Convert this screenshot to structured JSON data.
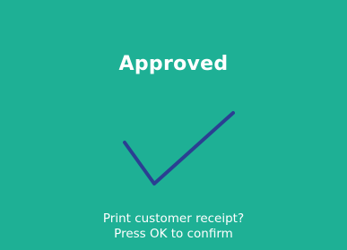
{
  "status": {
    "title": "Approved",
    "icon": "checkmark-icon",
    "check_color": "#2b3f92"
  },
  "prompt": {
    "line1": "Print customer receipt?",
    "line2": "Press OK to confirm"
  },
  "colors": {
    "background": "#1eb095",
    "text": "#ffffff"
  }
}
